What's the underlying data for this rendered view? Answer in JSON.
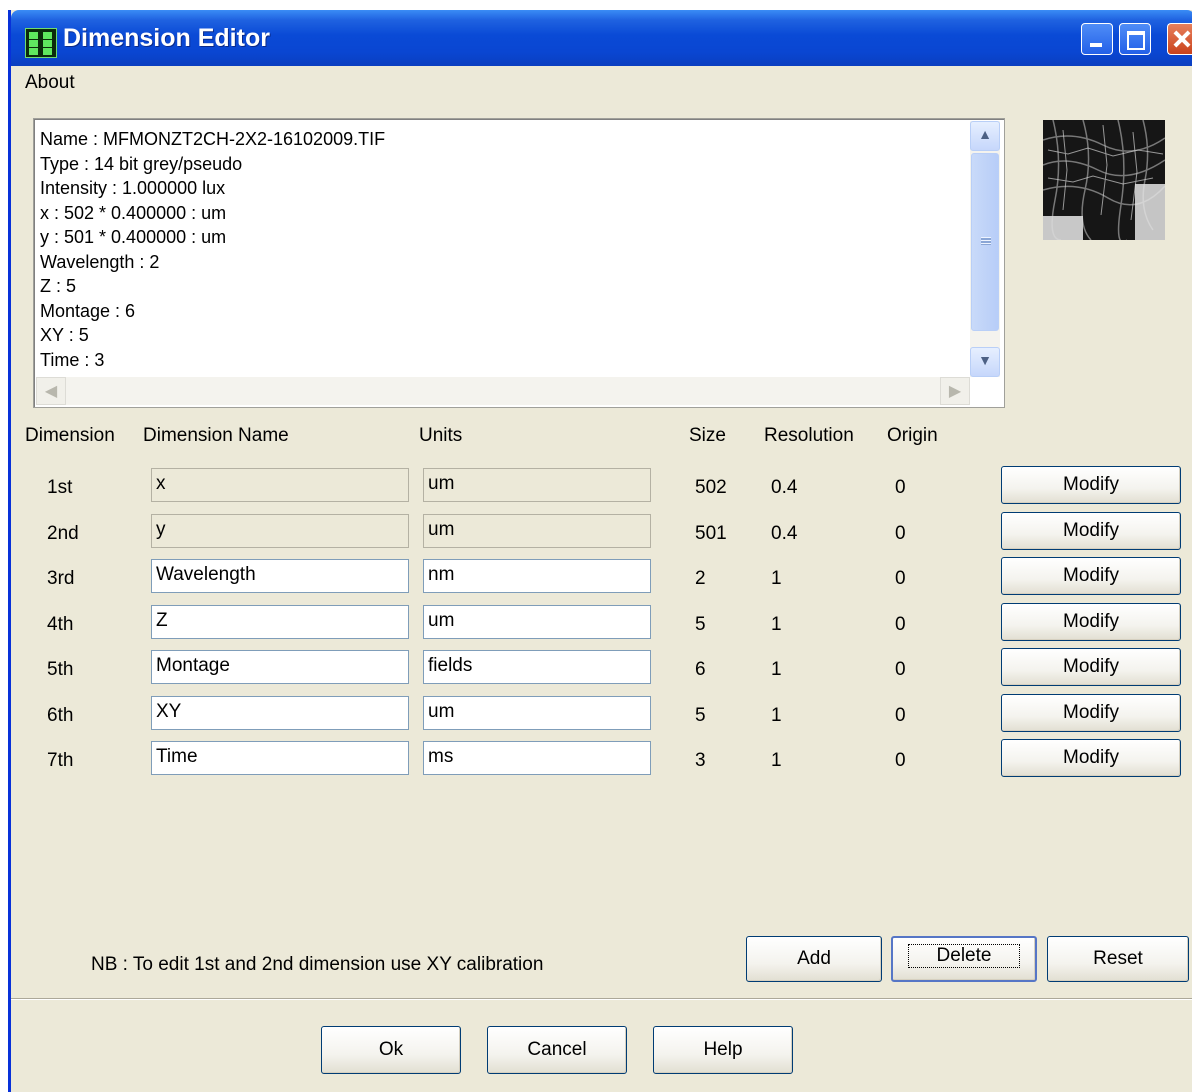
{
  "window": {
    "title": "Dimension Editor"
  },
  "menu": {
    "about": "About"
  },
  "info": {
    "lines": [
      "Name : MFMONZT2CH-2X2-16102009.TIF",
      "Type : 14 bit grey/pseudo",
      "Intensity : 1.000000 lux",
      "x : 502 * 0.400000 : um",
      "y : 501 * 0.400000 : um",
      "Wavelength : 2",
      "Z : 5",
      "Montage : 6",
      "XY : 5",
      "Time : 3"
    ]
  },
  "headers": {
    "dimension": "Dimension",
    "name": "Dimension Name",
    "units": "Units",
    "size": "Size",
    "resolution": "Resolution",
    "origin": "Origin"
  },
  "rows": [
    {
      "label": "1st",
      "name": "x",
      "units": "um",
      "size": "502",
      "resolution": "0.4",
      "origin": "0",
      "editable": false,
      "modify": "Modify"
    },
    {
      "label": "2nd",
      "name": "y",
      "units": "um",
      "size": "501",
      "resolution": "0.4",
      "origin": "0",
      "editable": false,
      "modify": "Modify"
    },
    {
      "label": "3rd",
      "name": "Wavelength",
      "units": "nm",
      "size": "2",
      "resolution": "1",
      "origin": "0",
      "editable": true,
      "modify": "Modify"
    },
    {
      "label": "4th",
      "name": "Z",
      "units": "um",
      "size": "5",
      "resolution": "1",
      "origin": "0",
      "editable": true,
      "modify": "Modify"
    },
    {
      "label": "5th",
      "name": "Montage",
      "units": "fields",
      "size": "6",
      "resolution": "1",
      "origin": "0",
      "editable": true,
      "modify": "Modify"
    },
    {
      "label": "6th",
      "name": "XY",
      "units": "um",
      "size": "5",
      "resolution": "1",
      "origin": "0",
      "editable": true,
      "modify": "Modify"
    },
    {
      "label": "7th",
      "name": "Time",
      "units": "ms",
      "size": "3",
      "resolution": "1",
      "origin": "0",
      "editable": true,
      "modify": "Modify"
    }
  ],
  "note": "NB : To edit 1st and 2nd dimension use XY calibration",
  "actions": {
    "add": "Add",
    "delete": "Delete",
    "reset": "Reset"
  },
  "footer": {
    "ok": "Ok",
    "cancel": "Cancel",
    "help": "Help"
  },
  "icons": {
    "app": "app-grid-icon",
    "minimize": "minimize-icon",
    "maximize": "maximize-icon",
    "close": "close-icon",
    "scroll_up": "chevron-up-icon",
    "scroll_down": "chevron-down-icon",
    "scroll_left": "chevron-left-icon",
    "scroll_right": "chevron-right-icon"
  }
}
